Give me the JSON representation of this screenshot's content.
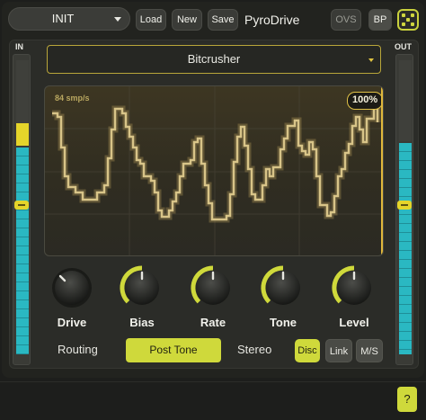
{
  "header": {
    "preset_name": "INIT",
    "load_label": "Load",
    "new_label": "New",
    "save_label": "Save",
    "title": "PyroDrive",
    "ovs_label": "OVS",
    "bp_label": "BP"
  },
  "meters": {
    "in_label": "IN",
    "out_label": "OUT"
  },
  "mode": {
    "selected": "Bitcrusher"
  },
  "scope": {
    "rate_label": "84 smp/s",
    "mix_percent": "100%"
  },
  "knobs": [
    {
      "label": "Drive",
      "value": 0.0
    },
    {
      "label": "Bias",
      "value": 0.5
    },
    {
      "label": "Rate",
      "value": 0.5
    },
    {
      "label": "Tone",
      "value": 0.5
    },
    {
      "label": "Level",
      "value": 0.5
    }
  ],
  "routing": {
    "label": "Routing",
    "selected": "Post Tone"
  },
  "stereo": {
    "label": "Stereo",
    "options": [
      "Disc",
      "Link",
      "M/S"
    ],
    "selected": "Disc"
  },
  "help_label": "?",
  "colors": {
    "accent": "#cfd93b",
    "meter_cyan": "#2ab8c2",
    "meter_yellow": "#e5d52a",
    "waveform": "#b49c5a"
  }
}
